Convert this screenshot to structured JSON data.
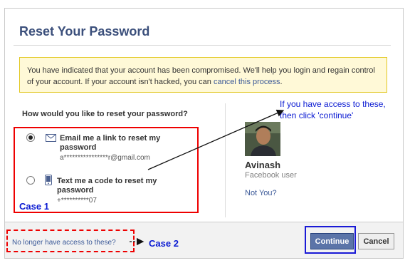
{
  "dialog": {
    "title": "Reset Your Password",
    "notice": {
      "text": "You have indicated that your account has been compromised. We'll help you login and regain control of your account. If your account isn't hacked, you can",
      "link": "cancel this process",
      "end": "."
    },
    "question": "How would you like to reset your password?"
  },
  "options": [
    {
      "icon": "envelope-icon",
      "label": "Email me a link to reset my password",
      "detail": "a****************r@gmail.com",
      "selected": true
    },
    {
      "icon": "phone-icon",
      "label": "Text me a code to reset my password",
      "detail": "+**********07",
      "selected": false
    }
  ],
  "profile": {
    "name": "Avinash",
    "subtitle": "Facebook user",
    "not_you": "Not You?"
  },
  "footer": {
    "no_access_link": "No longer have access to these?",
    "continue_label": "Continue",
    "cancel_label": "Cancel"
  },
  "annotations": {
    "case1": "Case 1",
    "case2": "Case 2",
    "hint_line1": "If you have access to these,",
    "hint_line2": "then click 'continue'"
  },
  "colors": {
    "title": "#3b4f7b",
    "link": "#3b5998",
    "notice_bg": "#fff9d7",
    "annotation_blue": "#0a1ad2",
    "annotation_red": "#ee0000",
    "continue_bg": "#5b74a8"
  }
}
